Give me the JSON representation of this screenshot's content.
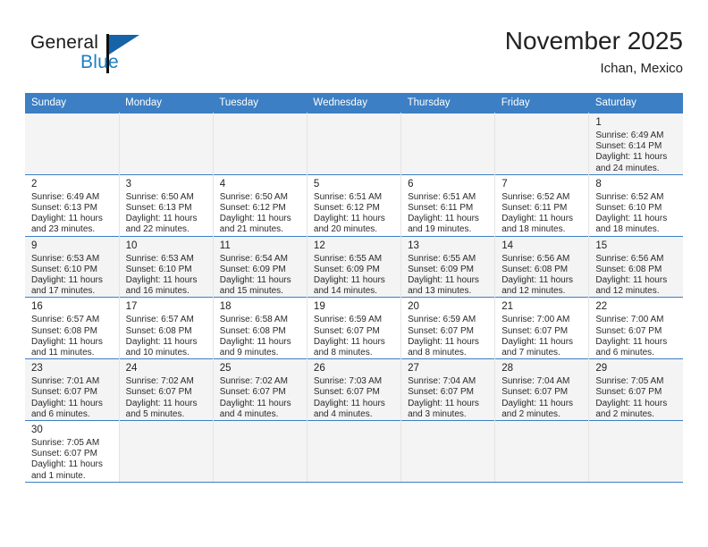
{
  "brand": {
    "name_top": "General",
    "name_bottom": "Blue",
    "accent_color": "#1c7fc4",
    "flag_color": "#1663a8"
  },
  "header": {
    "title": "November 2025",
    "subtitle": "Ichan, Mexico"
  },
  "theme": {
    "header_row_bg": "#3c7fc4",
    "header_row_text": "#ffffff",
    "shaded_row_bg": "#f4f4f4",
    "grid_line": "#e4e4e4"
  },
  "weekday_headers": [
    "Sunday",
    "Monday",
    "Tuesday",
    "Wednesday",
    "Thursday",
    "Friday",
    "Saturday"
  ],
  "weeks": [
    {
      "shaded": true,
      "days": [
        {
          "empty": true
        },
        {
          "empty": true
        },
        {
          "empty": true
        },
        {
          "empty": true
        },
        {
          "empty": true
        },
        {
          "empty": true
        },
        {
          "day": "1",
          "sunrise": "Sunrise: 6:49 AM",
          "sunset": "Sunset: 6:14 PM",
          "daylight_line1": "Daylight: 11 hours",
          "daylight_line2": "and 24 minutes."
        }
      ]
    },
    {
      "shaded": false,
      "days": [
        {
          "day": "2",
          "sunrise": "Sunrise: 6:49 AM",
          "sunset": "Sunset: 6:13 PM",
          "daylight_line1": "Daylight: 11 hours",
          "daylight_line2": "and 23 minutes."
        },
        {
          "day": "3",
          "sunrise": "Sunrise: 6:50 AM",
          "sunset": "Sunset: 6:13 PM",
          "daylight_line1": "Daylight: 11 hours",
          "daylight_line2": "and 22 minutes."
        },
        {
          "day": "4",
          "sunrise": "Sunrise: 6:50 AM",
          "sunset": "Sunset: 6:12 PM",
          "daylight_line1": "Daylight: 11 hours",
          "daylight_line2": "and 21 minutes."
        },
        {
          "day": "5",
          "sunrise": "Sunrise: 6:51 AM",
          "sunset": "Sunset: 6:12 PM",
          "daylight_line1": "Daylight: 11 hours",
          "daylight_line2": "and 20 minutes."
        },
        {
          "day": "6",
          "sunrise": "Sunrise: 6:51 AM",
          "sunset": "Sunset: 6:11 PM",
          "daylight_line1": "Daylight: 11 hours",
          "daylight_line2": "and 19 minutes."
        },
        {
          "day": "7",
          "sunrise": "Sunrise: 6:52 AM",
          "sunset": "Sunset: 6:11 PM",
          "daylight_line1": "Daylight: 11 hours",
          "daylight_line2": "and 18 minutes."
        },
        {
          "day": "8",
          "sunrise": "Sunrise: 6:52 AM",
          "sunset": "Sunset: 6:10 PM",
          "daylight_line1": "Daylight: 11 hours",
          "daylight_line2": "and 18 minutes."
        }
      ]
    },
    {
      "shaded": true,
      "days": [
        {
          "day": "9",
          "sunrise": "Sunrise: 6:53 AM",
          "sunset": "Sunset: 6:10 PM",
          "daylight_line1": "Daylight: 11 hours",
          "daylight_line2": "and 17 minutes."
        },
        {
          "day": "10",
          "sunrise": "Sunrise: 6:53 AM",
          "sunset": "Sunset: 6:10 PM",
          "daylight_line1": "Daylight: 11 hours",
          "daylight_line2": "and 16 minutes."
        },
        {
          "day": "11",
          "sunrise": "Sunrise: 6:54 AM",
          "sunset": "Sunset: 6:09 PM",
          "daylight_line1": "Daylight: 11 hours",
          "daylight_line2": "and 15 minutes."
        },
        {
          "day": "12",
          "sunrise": "Sunrise: 6:55 AM",
          "sunset": "Sunset: 6:09 PM",
          "daylight_line1": "Daylight: 11 hours",
          "daylight_line2": "and 14 minutes."
        },
        {
          "day": "13",
          "sunrise": "Sunrise: 6:55 AM",
          "sunset": "Sunset: 6:09 PM",
          "daylight_line1": "Daylight: 11 hours",
          "daylight_line2": "and 13 minutes."
        },
        {
          "day": "14",
          "sunrise": "Sunrise: 6:56 AM",
          "sunset": "Sunset: 6:08 PM",
          "daylight_line1": "Daylight: 11 hours",
          "daylight_line2": "and 12 minutes."
        },
        {
          "day": "15",
          "sunrise": "Sunrise: 6:56 AM",
          "sunset": "Sunset: 6:08 PM",
          "daylight_line1": "Daylight: 11 hours",
          "daylight_line2": "and 12 minutes."
        }
      ]
    },
    {
      "shaded": false,
      "days": [
        {
          "day": "16",
          "sunrise": "Sunrise: 6:57 AM",
          "sunset": "Sunset: 6:08 PM",
          "daylight_line1": "Daylight: 11 hours",
          "daylight_line2": "and 11 minutes."
        },
        {
          "day": "17",
          "sunrise": "Sunrise: 6:57 AM",
          "sunset": "Sunset: 6:08 PM",
          "daylight_line1": "Daylight: 11 hours",
          "daylight_line2": "and 10 minutes."
        },
        {
          "day": "18",
          "sunrise": "Sunrise: 6:58 AM",
          "sunset": "Sunset: 6:08 PM",
          "daylight_line1": "Daylight: 11 hours",
          "daylight_line2": "and 9 minutes."
        },
        {
          "day": "19",
          "sunrise": "Sunrise: 6:59 AM",
          "sunset": "Sunset: 6:07 PM",
          "daylight_line1": "Daylight: 11 hours",
          "daylight_line2": "and 8 minutes."
        },
        {
          "day": "20",
          "sunrise": "Sunrise: 6:59 AM",
          "sunset": "Sunset: 6:07 PM",
          "daylight_line1": "Daylight: 11 hours",
          "daylight_line2": "and 8 minutes."
        },
        {
          "day": "21",
          "sunrise": "Sunrise: 7:00 AM",
          "sunset": "Sunset: 6:07 PM",
          "daylight_line1": "Daylight: 11 hours",
          "daylight_line2": "and 7 minutes."
        },
        {
          "day": "22",
          "sunrise": "Sunrise: 7:00 AM",
          "sunset": "Sunset: 6:07 PM",
          "daylight_line1": "Daylight: 11 hours",
          "daylight_line2": "and 6 minutes."
        }
      ]
    },
    {
      "shaded": true,
      "days": [
        {
          "day": "23",
          "sunrise": "Sunrise: 7:01 AM",
          "sunset": "Sunset: 6:07 PM",
          "daylight_line1": "Daylight: 11 hours",
          "daylight_line2": "and 6 minutes."
        },
        {
          "day": "24",
          "sunrise": "Sunrise: 7:02 AM",
          "sunset": "Sunset: 6:07 PM",
          "daylight_line1": "Daylight: 11 hours",
          "daylight_line2": "and 5 minutes."
        },
        {
          "day": "25",
          "sunrise": "Sunrise: 7:02 AM",
          "sunset": "Sunset: 6:07 PM",
          "daylight_line1": "Daylight: 11 hours",
          "daylight_line2": "and 4 minutes."
        },
        {
          "day": "26",
          "sunrise": "Sunrise: 7:03 AM",
          "sunset": "Sunset: 6:07 PM",
          "daylight_line1": "Daylight: 11 hours",
          "daylight_line2": "and 4 minutes."
        },
        {
          "day": "27",
          "sunrise": "Sunrise: 7:04 AM",
          "sunset": "Sunset: 6:07 PM",
          "daylight_line1": "Daylight: 11 hours",
          "daylight_line2": "and 3 minutes."
        },
        {
          "day": "28",
          "sunrise": "Sunrise: 7:04 AM",
          "sunset": "Sunset: 6:07 PM",
          "daylight_line1": "Daylight: 11 hours",
          "daylight_line2": "and 2 minutes."
        },
        {
          "day": "29",
          "sunrise": "Sunrise: 7:05 AM",
          "sunset": "Sunset: 6:07 PM",
          "daylight_line1": "Daylight: 11 hours",
          "daylight_line2": "and 2 minutes."
        }
      ]
    },
    {
      "shaded": false,
      "days": [
        {
          "day": "30",
          "sunrise": "Sunrise: 7:05 AM",
          "sunset": "Sunset: 6:07 PM",
          "daylight_line1": "Daylight: 11 hours",
          "daylight_line2": "and 1 minute."
        },
        {
          "empty": true
        },
        {
          "empty": true
        },
        {
          "empty": true
        },
        {
          "empty": true
        },
        {
          "empty": true
        },
        {
          "empty": true
        }
      ]
    }
  ]
}
